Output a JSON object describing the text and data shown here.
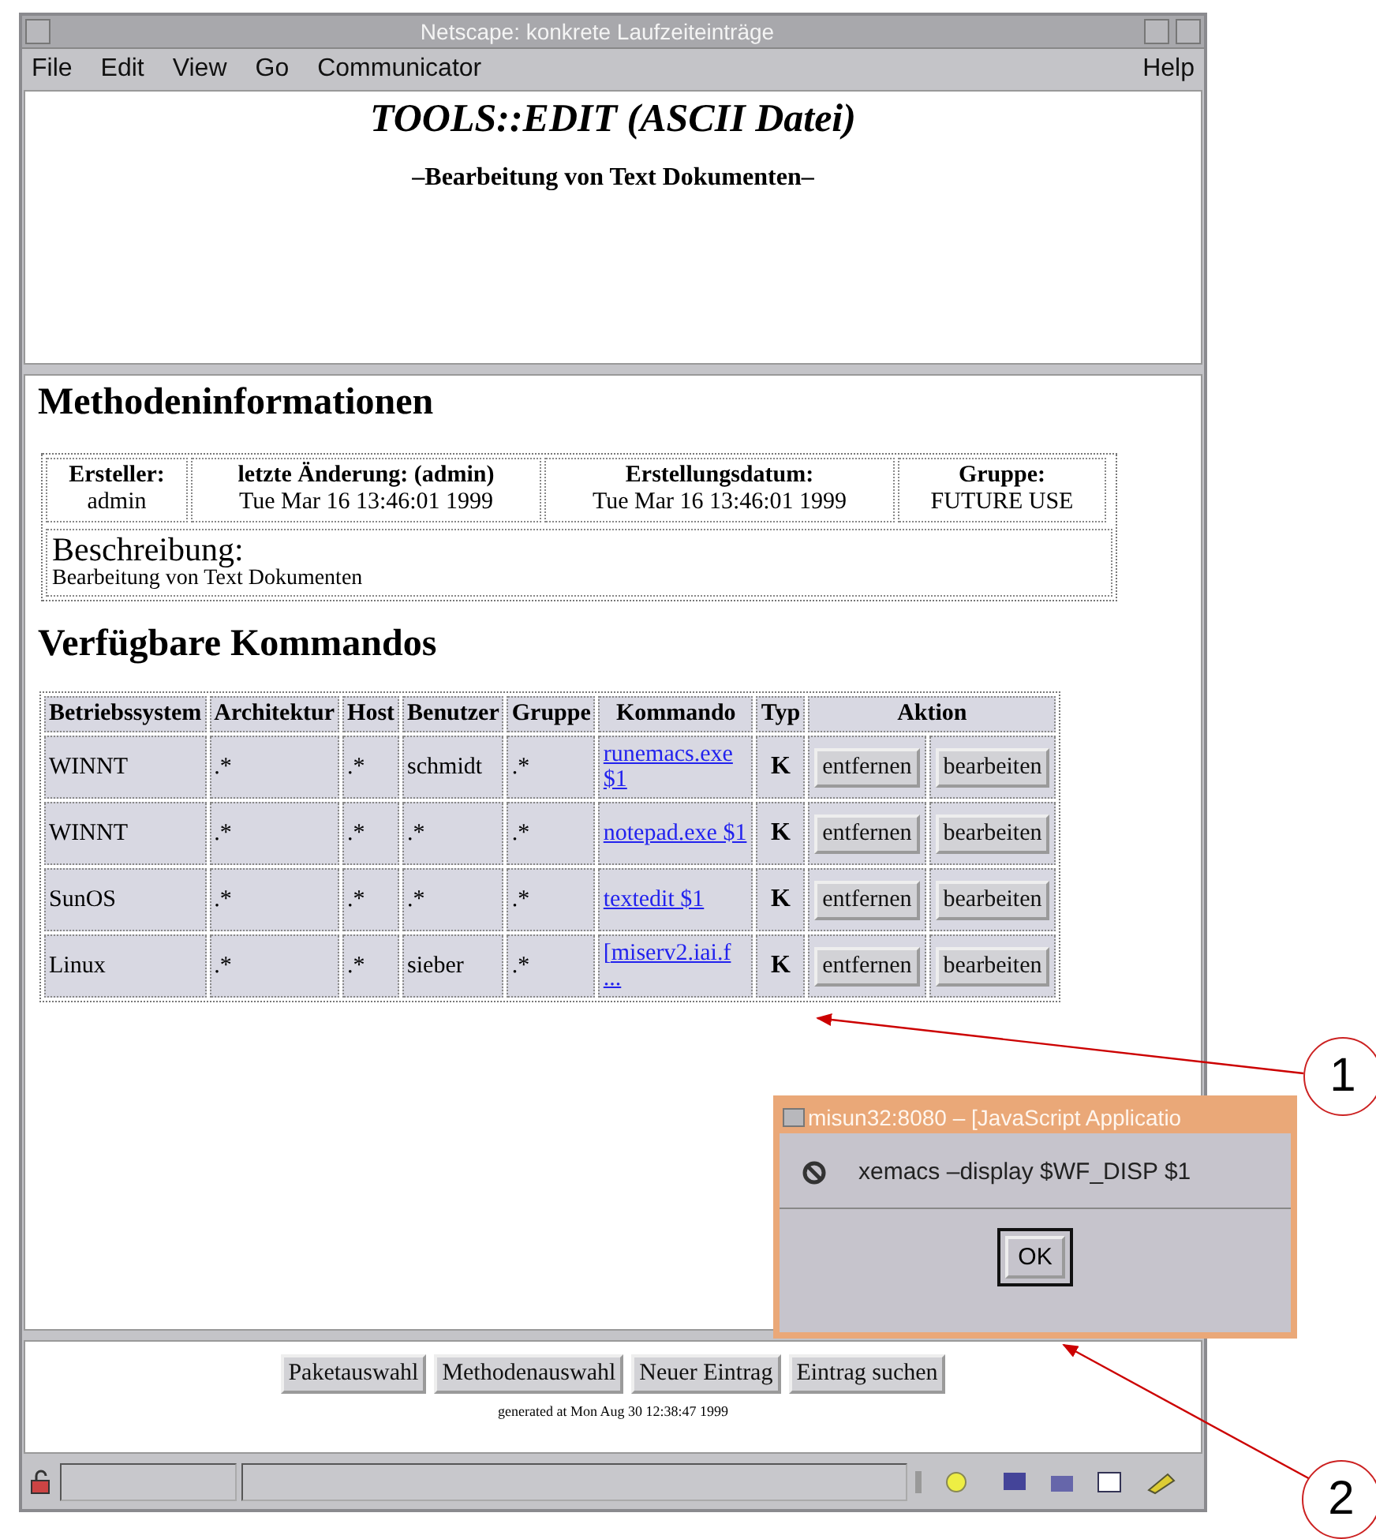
{
  "window": {
    "title": "Netscape: konkrete Laufzeiteinträge"
  },
  "menu": {
    "left": [
      "File",
      "Edit",
      "View",
      "Go",
      "Communicator"
    ],
    "right": [
      "Help"
    ]
  },
  "header": {
    "title": "TOOLS::EDIT (ASCII Datei)",
    "subtitle": "–Bearbeitung von Text Dokumenten–"
  },
  "method_info": {
    "heading": "Methodeninformationen",
    "fields": [
      {
        "label": "Ersteller:",
        "value": "admin"
      },
      {
        "label": "letzte Änderung: (admin)",
        "value": "Tue Mar 16 13:46:01 1999"
      },
      {
        "label": "Erstellungsdatum:",
        "value": "Tue Mar 16 13:46:01 1999"
      },
      {
        "label": "Gruppe:",
        "value": "FUTURE USE"
      }
    ],
    "description": {
      "label": "Beschreibung:",
      "text": "Bearbeitung von Text Dokumenten"
    }
  },
  "commands": {
    "heading": "Verfügbare Kommandos",
    "columns": [
      "Betriebssystem",
      "Architektur",
      "Host",
      "Benutzer",
      "Gruppe",
      "Kommando",
      "Typ",
      "Aktion"
    ],
    "rows": [
      {
        "os": "WINNT",
        "arch": ".*",
        "host": ".*",
        "user": "schmidt",
        "group": ".*",
        "command": "runemacs.exe $1",
        "type": "K",
        "actions": [
          "entfernen",
          "bearbeiten"
        ]
      },
      {
        "os": "WINNT",
        "arch": ".*",
        "host": ".*",
        "user": ".*",
        "group": ".*",
        "command": "notepad.exe $1",
        "type": "K",
        "actions": [
          "entfernen",
          "bearbeiten"
        ]
      },
      {
        "os": "SunOS",
        "arch": ".*",
        "host": ".*",
        "user": ".*",
        "group": ".*",
        "command": "textedit $1",
        "type": "K",
        "actions": [
          "entfernen",
          "bearbeiten"
        ]
      },
      {
        "os": "Linux",
        "arch": ".*",
        "host": ".*",
        "user": "sieber",
        "group": ".*",
        "command": "[miserv2.iai.f ...",
        "type": "K",
        "actions": [
          "entfernen",
          "bearbeiten"
        ]
      }
    ]
  },
  "footer_buttons": [
    "Paketauswahl",
    "Methodenauswahl",
    "Neuer Eintrag",
    "Eintrag suchen"
  ],
  "generated": "generated at Mon Aug 30 12:38:47 1999",
  "dialog": {
    "title": "misun32:8080 – [JavaScript Applicatio",
    "message": "xemacs –display $WF_DISP $1",
    "button": "OK"
  },
  "callouts": [
    "1",
    "2"
  ]
}
